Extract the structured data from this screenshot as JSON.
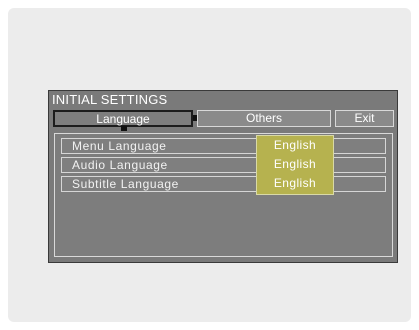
{
  "window": {
    "title": "INITIAL SETTINGS"
  },
  "tabs": [
    {
      "label": "Language",
      "selected": true
    },
    {
      "label": "Others",
      "selected": false
    },
    {
      "label": "Exit",
      "selected": false
    }
  ],
  "settings": [
    {
      "label": "Menu Language",
      "value": "English"
    },
    {
      "label": "Audio Language",
      "value": "English"
    },
    {
      "label": "Subtitle Language",
      "value": "English"
    }
  ],
  "colors": {
    "background": "#ececec",
    "osd_panel": "#7a7a7a",
    "highlight": "#b6b24f",
    "text": "#ffffff"
  }
}
